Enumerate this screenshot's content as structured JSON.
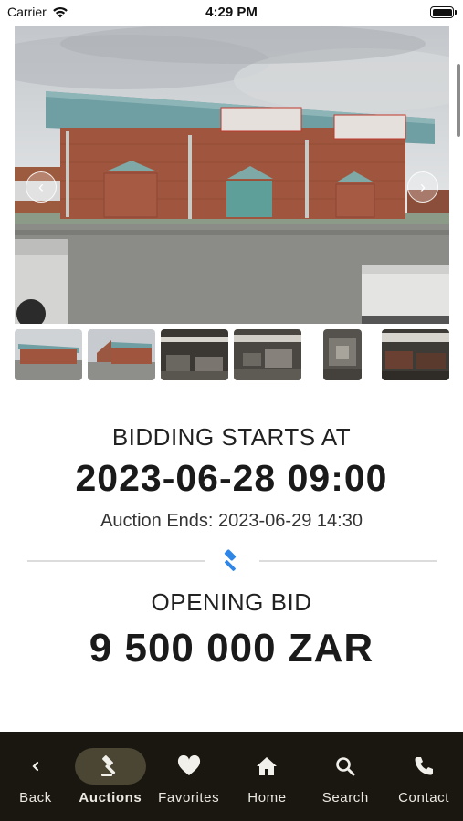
{
  "status_bar": {
    "carrier": "Carrier",
    "time": "4:29 PM"
  },
  "gallery": {
    "prev_icon": "chevron-left-icon",
    "next_icon": "chevron-right-icon",
    "thumbnail_count": 6
  },
  "auction": {
    "bid_start_label": "BIDDING STARTS AT",
    "bid_start_value": "2023-06-28 09:00",
    "auction_ends": "Auction Ends: 2023-06-29 14:30",
    "divider_icon": "gavel-icon",
    "opening_bid_label": "OPENING BID",
    "opening_bid_value": "9 500 000 ZAR"
  },
  "tabbar": {
    "items": [
      {
        "label": "Back",
        "icon": "chevron-left-icon"
      },
      {
        "label": "Auctions",
        "icon": "gavel-icon"
      },
      {
        "label": "Favorites",
        "icon": "heart-icon"
      },
      {
        "label": "Home",
        "icon": "home-icon"
      },
      {
        "label": "Search",
        "icon": "search-icon"
      },
      {
        "label": "Contact",
        "icon": "phone-icon"
      }
    ],
    "active_index": 1
  },
  "colors": {
    "tabbar_bg": "#1a1711",
    "active_pill": "#4a4633",
    "accent_gavel": "#2f86e6"
  }
}
